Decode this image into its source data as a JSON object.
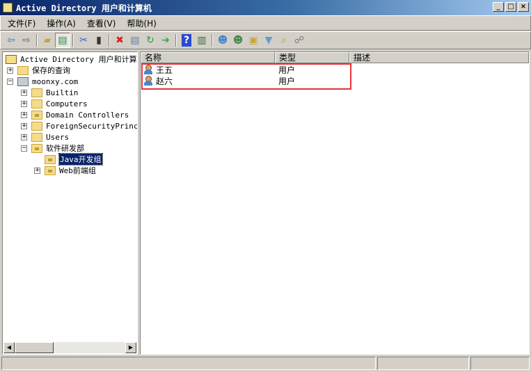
{
  "window": {
    "title": "Active Directory 用户和计算机",
    "buttons": [
      "_",
      "□",
      "×"
    ]
  },
  "menu": [
    "文件(F)",
    "操作(A)",
    "查看(V)",
    "帮助(H)"
  ],
  "toolbar": [
    "back-icon",
    "forward-icon",
    "|",
    "up-folder-icon",
    "show-hide-tree-icon",
    "|",
    "cut-icon",
    "clipboard-icon",
    "|",
    "delete-icon",
    "properties-icon",
    "refresh-icon",
    "export-list-icon",
    "|",
    "help-icon",
    "console-tree-icon",
    "|",
    "new-user-icon",
    "new-group-icon",
    "new-ou-icon",
    "filter-icon",
    "find-icon",
    "add-to-group-icon"
  ],
  "tree": {
    "root": "Active Directory 用户和计算机",
    "saved_queries": "保存的查询",
    "domain": "moonxy.com",
    "children": [
      "Builtin",
      "Computers",
      "Domain Controllers",
      "ForeignSecurityPrincipals",
      "Users",
      "软件研发部"
    ],
    "ou_children": [
      "Java开发组",
      "Web前端组"
    ]
  },
  "list": {
    "columns": [
      "名称",
      "类型",
      "描述"
    ],
    "rows": [
      {
        "name": "王五",
        "type": "用户",
        "desc": ""
      },
      {
        "name": "赵六",
        "type": "用户",
        "desc": ""
      }
    ]
  },
  "highlight_color": "#e8303a"
}
